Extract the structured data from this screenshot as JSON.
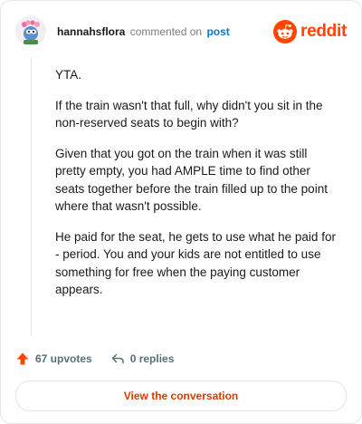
{
  "comment": {
    "author": "hannahsflora",
    "action_text": "commented on",
    "post_link": "post",
    "paragraphs": [
      "YTA.",
      "If the train wasn't that full, why didn't you sit in the non-reserved seats to begin with?",
      "Given that you got on the train when it was still pretty empty, you had AMPLE time to find other seats together before the train filled up to the point where that wasn't possible.",
      "He paid for the seat, he gets to use what he paid for - period. You and your kids are not entitled to use something for free when the paying customer appears."
    ]
  },
  "brand": {
    "name": "reddit",
    "icon": "reddit-snoo-icon",
    "color": "#ff4500"
  },
  "footer": {
    "upvotes_label": "67 upvotes",
    "upvote_icon": "upvote-arrow-icon",
    "upvote_color": "#ff4500",
    "replies_label": "0 replies",
    "reply_icon": "reply-arrow-icon",
    "cta_label": "View the conversation",
    "cta_color": "#d93a00"
  }
}
